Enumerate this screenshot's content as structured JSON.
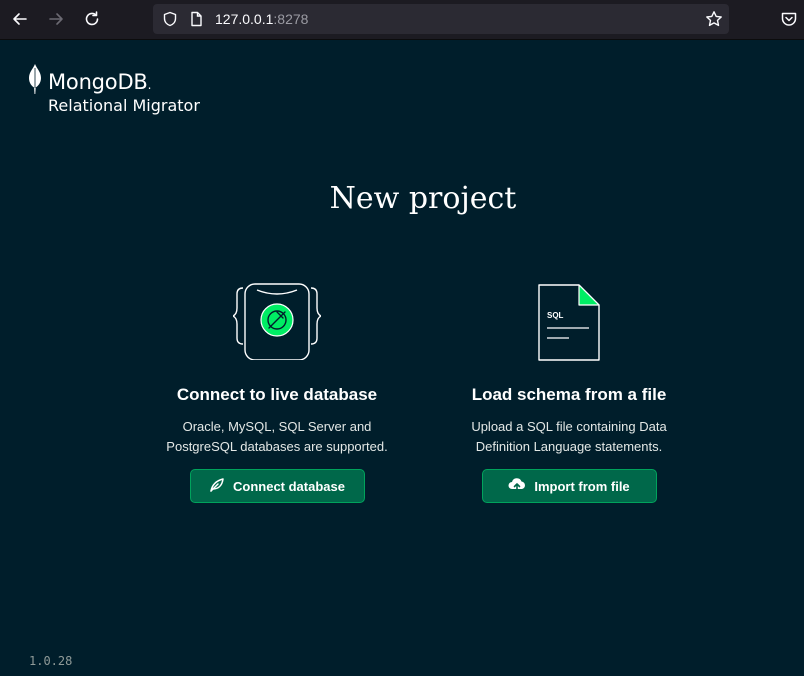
{
  "browser": {
    "url_host": "127.0.0.1",
    "url_port": ":8278",
    "icons": [
      "back-icon",
      "forward-icon",
      "reload-icon",
      "shield-icon",
      "page-icon",
      "bookmark-star-icon",
      "pocket-icon"
    ]
  },
  "app": {
    "brand": "MongoDB",
    "brand_mark": ".",
    "product": "Relational Migrator"
  },
  "page": {
    "title": "New project"
  },
  "options": {
    "connect": {
      "title": "Connect to live database",
      "desc_line1": "Oracle, MySQL, SQL Server and",
      "desc_line2": "PostgreSQL databases are supported.",
      "button_label": "Connect database",
      "button_icon": "leaf-icon"
    },
    "import": {
      "title": "Load schema from a file",
      "desc_line1": "Upload a SQL file containing Data",
      "desc_line2": "Definition Language statements.",
      "button_label": "Import from file",
      "button_icon": "cloud-upload-icon",
      "file_label": "SQL"
    }
  },
  "footer": {
    "version": "1.0.28"
  },
  "colors": {
    "background": "#001e2b",
    "button_bg": "#00684a",
    "button_border": "#00a35c",
    "accent_green": "#00ed64"
  }
}
